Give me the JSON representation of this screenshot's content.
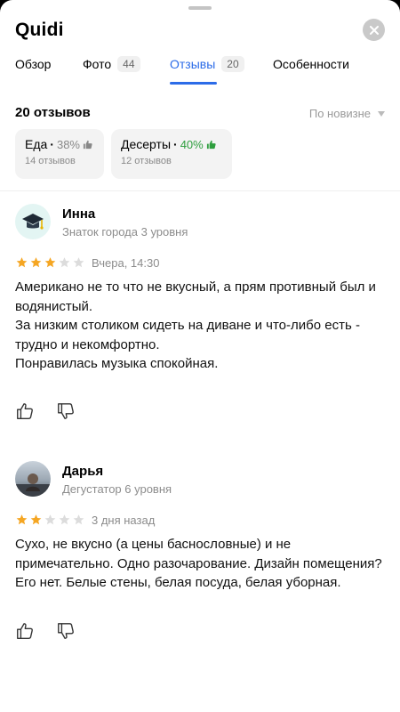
{
  "place": {
    "name": "Quidi"
  },
  "tabs": [
    {
      "label": "Обзор",
      "count": ""
    },
    {
      "label": "Фото",
      "count": "44"
    },
    {
      "label": "Отзывы",
      "count": "20"
    },
    {
      "label": "Особенности",
      "count": ""
    }
  ],
  "active_tab": "Отзывы",
  "reviews_summary": {
    "count_label": "20 отзывов",
    "sort_label": "По новизне"
  },
  "aspects": [
    {
      "name": "Еда",
      "percent": "38%",
      "reviews": "14 отзывов",
      "percent_color": "#888888"
    },
    {
      "name": "Десерты",
      "percent": "40%",
      "reviews": "12 отзывов",
      "percent_color": "#2e9e3e"
    }
  ],
  "reviews": [
    {
      "author": "Инна",
      "level": "Знаток города 3 уровня",
      "rating": 3,
      "date": "Вчера, 14:30",
      "text": "Американо не то что не вкусный, а прям противный был и водянистый.\nЗа низким столиком сидеть на диване и что-либо есть - трудно и некомфортно.\nПонравилась музыка спокойная.",
      "avatar_icon": "graduation-cap-icon"
    },
    {
      "author": "Дарья",
      "level": "Дегустатор 6 уровня",
      "rating": 2,
      "date": "3 дня назад",
      "text": "Сухо, не вкусно (а цены баснословные) и не примечательно. Одно разочарование. Дизайн помещения? Его нет. Белые стены, белая посуда, белая уборная.",
      "avatar_icon": "photo-avatar"
    }
  ],
  "colors": {
    "accent": "#2c6ce8",
    "star": "#f5a623",
    "star_empty": "#dcdcdc",
    "positive": "#2e9e3e"
  }
}
